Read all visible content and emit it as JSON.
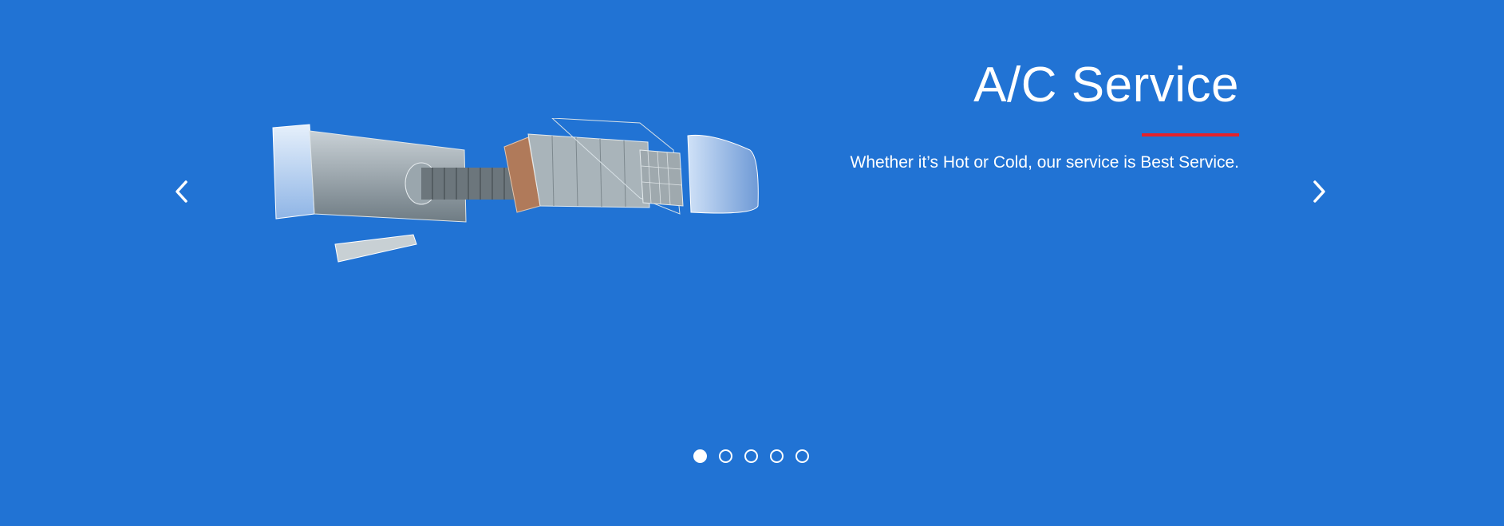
{
  "slider": {
    "title": "A/C Service",
    "subtitle": "Whether it’s Hot or Cold, our service is Best Service.",
    "prev_icon": "chevron-left-icon",
    "next_icon": "chevron-right-icon",
    "slide_count": 5,
    "active_index": 0,
    "image_subject": "exploded air conditioner unit",
    "colors": {
      "background": "#2173d4",
      "accent": "#e5222a",
      "text": "#ffffff"
    }
  }
}
